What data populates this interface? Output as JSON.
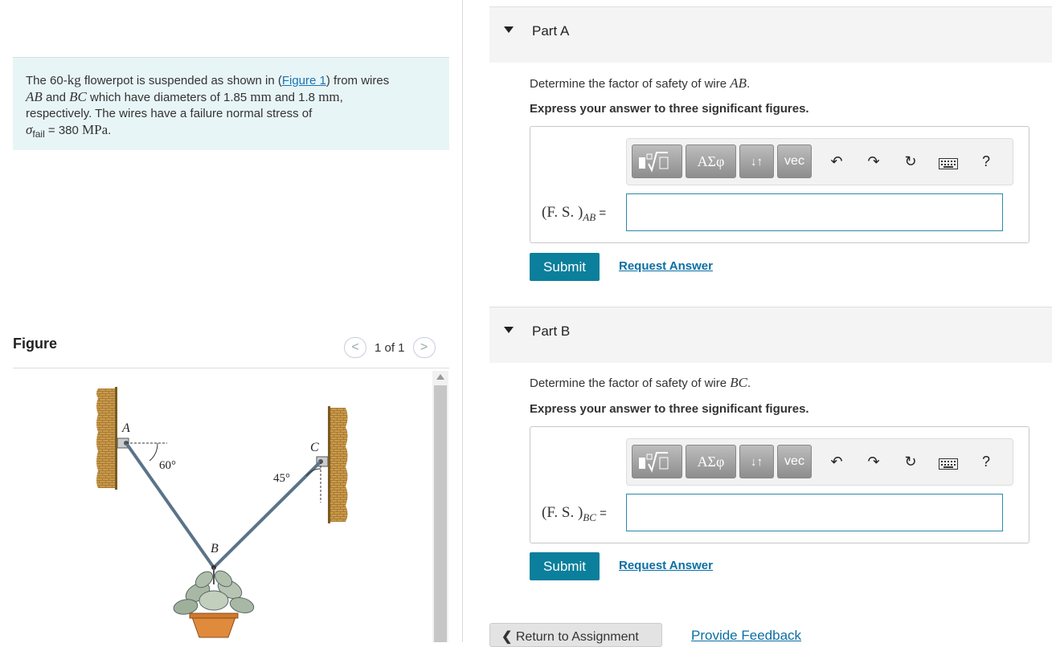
{
  "problem": {
    "t1": "The 60-",
    "kg": "kg",
    "t2": " flowerpot is suspended as shown in (",
    "figure_link": "Figure 1",
    "t3": ") from wires",
    "ab": "AB",
    "t4": " and ",
    "bc": "BC",
    "t5": " which have diameters of 1.85 ",
    "mm1": "mm",
    "t6": " and 1.8 ",
    "mm2": "mm",
    "t7": ",",
    "t8": "respectively. The wires have a failure normal stress of",
    "sigma": "σ",
    "fail": "fail",
    "t9": " = 380 ",
    "mpa": "MPa",
    "t10": "."
  },
  "figure": {
    "title": "Figure",
    "pager": "1 of 1",
    "prev": "<",
    "next": ">",
    "label_a": "A",
    "label_b": "B",
    "label_c": "C",
    "angle_a": "60°",
    "angle_c": "45°"
  },
  "parts": [
    {
      "label": "Part A",
      "question_pre": "Determine the factor of safety of wire ",
      "wire": "AB",
      "question_post": ".",
      "instruction": "Express your answer to three significant figures.",
      "input_label": "(F. S. )",
      "input_sub": "AB",
      "input_eq": " =",
      "submit": "Submit",
      "request": "Request Answer"
    },
    {
      "label": "Part B",
      "question_pre": "Determine the factor of safety of wire ",
      "wire": "BC",
      "question_post": ".",
      "instruction": "Express your answer to three significant figures.",
      "input_label": "(F. S. )",
      "input_sub": "BC",
      "input_eq": " =",
      "submit": "Submit",
      "request": "Request Answer"
    }
  ],
  "toolbar": {
    "greek": "ΑΣφ",
    "arrows": "↓↑",
    "vec": "vec",
    "help": "?",
    "icons": [
      "templates-icon",
      "greek-icon",
      "subscript-icon",
      "vector-icon",
      "undo-icon",
      "redo-icon",
      "reset-icon",
      "keyboard-icon",
      "help-icon"
    ]
  },
  "footer": {
    "return": "Return to Assignment",
    "feedback": "Provide Feedback"
  }
}
